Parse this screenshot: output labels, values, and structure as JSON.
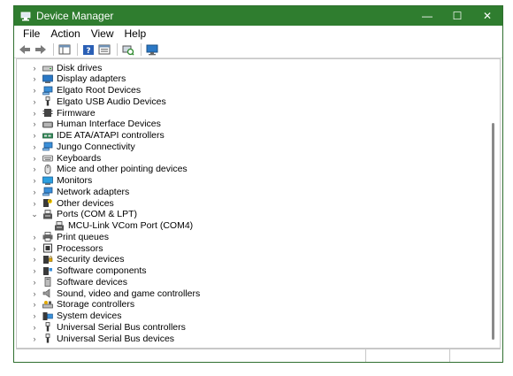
{
  "window": {
    "title": "Device Manager",
    "controls": {
      "minimize": "—",
      "maximize": "☐",
      "close": "✕"
    }
  },
  "menu": [
    "File",
    "Action",
    "View",
    "Help"
  ],
  "tree": [
    {
      "label": "Disk drives",
      "icon": "disk-drive-icon",
      "expanded": false
    },
    {
      "label": "Display adapters",
      "icon": "display-adapter-icon",
      "expanded": false
    },
    {
      "label": "Elgato Root Devices",
      "icon": "network-icon",
      "expanded": false
    },
    {
      "label": "Elgato USB Audio Devices",
      "icon": "usb-icon",
      "expanded": false
    },
    {
      "label": "Firmware",
      "icon": "firmware-icon",
      "expanded": false
    },
    {
      "label": "Human Interface Devices",
      "icon": "hid-icon",
      "expanded": false
    },
    {
      "label": "IDE ATA/ATAPI controllers",
      "icon": "ide-controller-icon",
      "expanded": false
    },
    {
      "label": "Jungo Connectivity",
      "icon": "network-icon",
      "expanded": false
    },
    {
      "label": "Keyboards",
      "icon": "keyboard-icon",
      "expanded": false
    },
    {
      "label": "Mice and other pointing devices",
      "icon": "mouse-icon",
      "expanded": false
    },
    {
      "label": "Monitors",
      "icon": "monitor-icon",
      "expanded": false
    },
    {
      "label": "Network adapters",
      "icon": "network-icon",
      "expanded": false
    },
    {
      "label": "Other devices",
      "icon": "other-device-icon",
      "expanded": false
    },
    {
      "label": "Ports (COM & LPT)",
      "icon": "port-icon",
      "expanded": true
    },
    {
      "label": "MCU-Link VCom Port (COM4)",
      "icon": "port-icon",
      "child": true
    },
    {
      "label": "Print queues",
      "icon": "printer-icon",
      "expanded": false
    },
    {
      "label": "Processors",
      "icon": "processor-icon",
      "expanded": false
    },
    {
      "label": "Security devices",
      "icon": "security-icon",
      "expanded": false
    },
    {
      "label": "Software components",
      "icon": "software-component-icon",
      "expanded": false
    },
    {
      "label": "Software devices",
      "icon": "software-device-icon",
      "expanded": false
    },
    {
      "label": "Sound, video and game controllers",
      "icon": "speaker-icon",
      "expanded": false
    },
    {
      "label": "Storage controllers",
      "icon": "storage-controller-icon",
      "expanded": false
    },
    {
      "label": "System devices",
      "icon": "system-device-icon",
      "expanded": false
    },
    {
      "label": "Universal Serial Bus controllers",
      "icon": "usb-icon",
      "expanded": false
    },
    {
      "label": "Universal Serial Bus devices",
      "icon": "usb-icon",
      "expanded": false
    }
  ],
  "colors": {
    "titlebar": "#2f7d2f",
    "accent": "#1e73be"
  }
}
